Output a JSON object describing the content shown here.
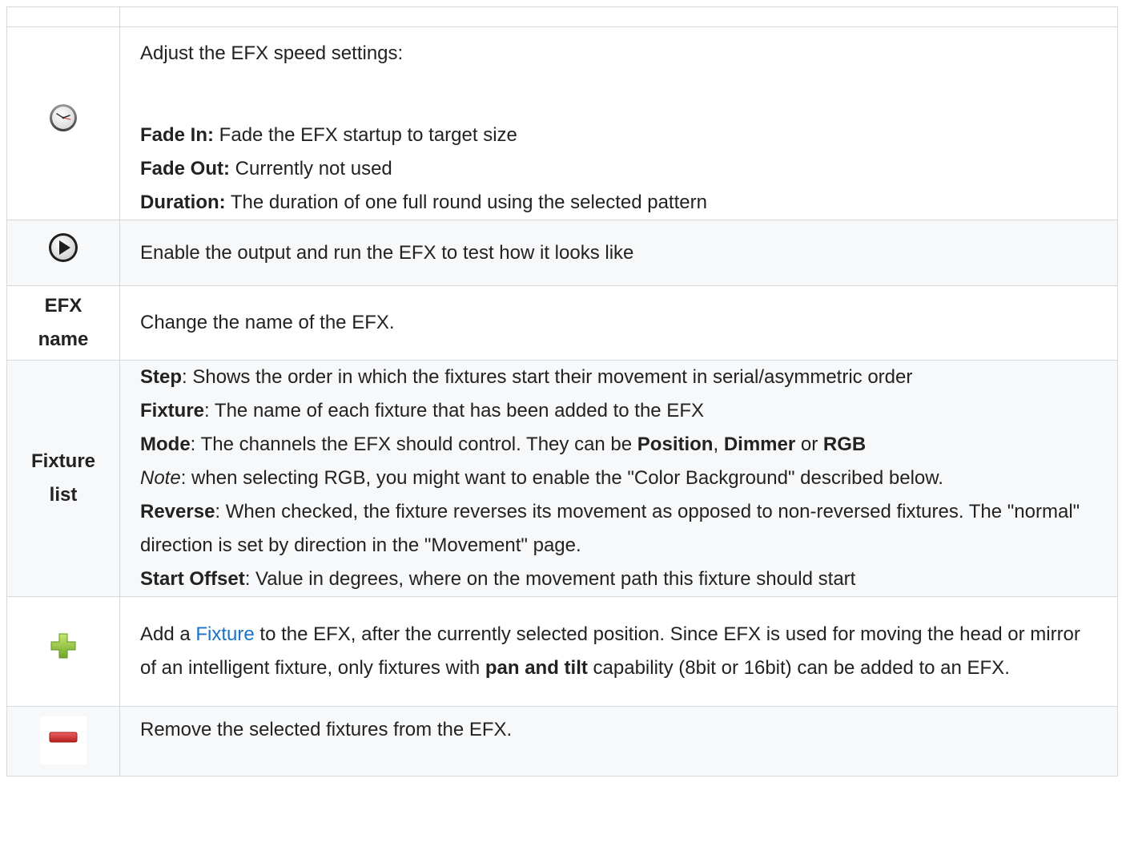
{
  "rows": {
    "speed": {
      "icon": "clock-icon",
      "intro": "Adjust the EFX speed settings:",
      "items": [
        {
          "term": "Fade In:",
          "text": " Fade the EFX startup to target size"
        },
        {
          "term": "Fade Out:",
          "text": " Currently not used"
        },
        {
          "term": "Duration:",
          "text": " The duration of one full round using the selected pattern"
        }
      ]
    },
    "play": {
      "icon": "play-icon",
      "text": "Enable the output and run the EFX to test how it looks like"
    },
    "name": {
      "label_line1": "EFX",
      "label_line2": "name",
      "text": "Change the name of the EFX."
    },
    "fixture_list": {
      "label_line1": "Fixture",
      "label_line2": "list",
      "step_term": "Step",
      "step_text": ": Shows the order in which the fixtures start their movement in serial/asymmetric order",
      "fixture_term": "Fixture",
      "fixture_text": ": The name of each fixture that has been added to the EFX",
      "mode_term": "Mode",
      "mode_text": ": The channels the EFX should control. They can be ",
      "mode_opt1": "Position",
      "mode_sep1": ", ",
      "mode_opt2": "Dimmer",
      "mode_sep2": " or ",
      "mode_opt3": "RGB",
      "note_term": "Note",
      "note_text": ": when selecting RGB, you might want to enable the \"Color Background\" described below.",
      "reverse_term": "Reverse",
      "reverse_text": ": When checked, the fixture reverses its movement as opposed to non-reversed fixtures. The \"normal\" direction is set by direction in the \"Movement\" page.",
      "offset_term": "Start Offset",
      "offset_text": ": Value in degrees, where on the movement path this fixture should start"
    },
    "add": {
      "icon": "plus-icon",
      "text_before": "Add a ",
      "link_text": "Fixture",
      "text_middle": " to the EFX, after the currently selected position. Since EFX is used for moving the head or mirror of an intelligent fixture, only fixtures with ",
      "bold_text": "pan and tilt",
      "text_after": " capability (8bit or 16bit) can be added to an EFX."
    },
    "remove": {
      "icon": "minus-icon",
      "text": "Remove the selected fixtures from the EFX."
    }
  },
  "colors": {
    "link": "#1a73c8",
    "border": "#d6d9dc",
    "alt_row": "#f7f8fa",
    "plus_green": "#8cc63f",
    "minus_red": "#d32f2f"
  }
}
